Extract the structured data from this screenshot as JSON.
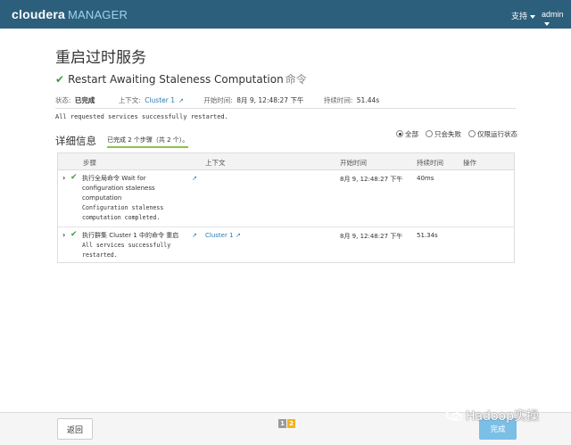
{
  "app": {
    "brand": "cloudera",
    "brand_suffix": "MANAGER"
  },
  "topnav": {
    "support": "支持",
    "user": "admin"
  },
  "page": {
    "title": "重启过时服务"
  },
  "command": {
    "name": "Restart Awaiting Staleness Computation",
    "tag": "命令"
  },
  "status": {
    "status_label": "状态:",
    "status_value": "已完成",
    "context_label": "上下文:",
    "context_value": "Cluster 1",
    "start_label": "开始时间:",
    "start_value": "8月 9, 12:48:27 下午",
    "duration_label": "持续时间:",
    "duration_value": "51.44s"
  },
  "result_message": "All requested services successfully restarted.",
  "details": {
    "title": "详细信息",
    "progress": "已完成 2 个步骤（共 2 个）。",
    "filters": [
      {
        "label": "全部",
        "selected": true
      },
      {
        "label": "只会失败",
        "selected": false
      },
      {
        "label": "仅限运行状态",
        "selected": false
      }
    ]
  },
  "table": {
    "headers": [
      "步骤",
      "上下文",
      "开始时间",
      "持续时间",
      "操作"
    ],
    "rows": [
      {
        "step_line1": "执行全局命令 Wait for",
        "step_line2": "configuration staleness",
        "step_line3": "computation",
        "msg_line1": "Configuration staleness",
        "msg_line2": "computation completed.",
        "context": "",
        "start": "8月 9, 12:48:27 下午",
        "duration": "40ms"
      },
      {
        "step_line1": "执行群集 Cluster 1 中的命令 重启",
        "msg_line1": "All services successfully",
        "msg_line2": "restarted.",
        "context": "Cluster 1",
        "start": "8月 9, 12:48:27 下午",
        "duration": "51.34s"
      }
    ]
  },
  "footer": {
    "back": "返回",
    "finish": "完成",
    "pages": [
      "1",
      "2"
    ]
  },
  "watermark": "Hadoop实操",
  "colors": {
    "topbar": "#2c5f7c",
    "success": "#3d9e3d",
    "link": "#2a7ab5",
    "finish": "#7bbfe6"
  }
}
